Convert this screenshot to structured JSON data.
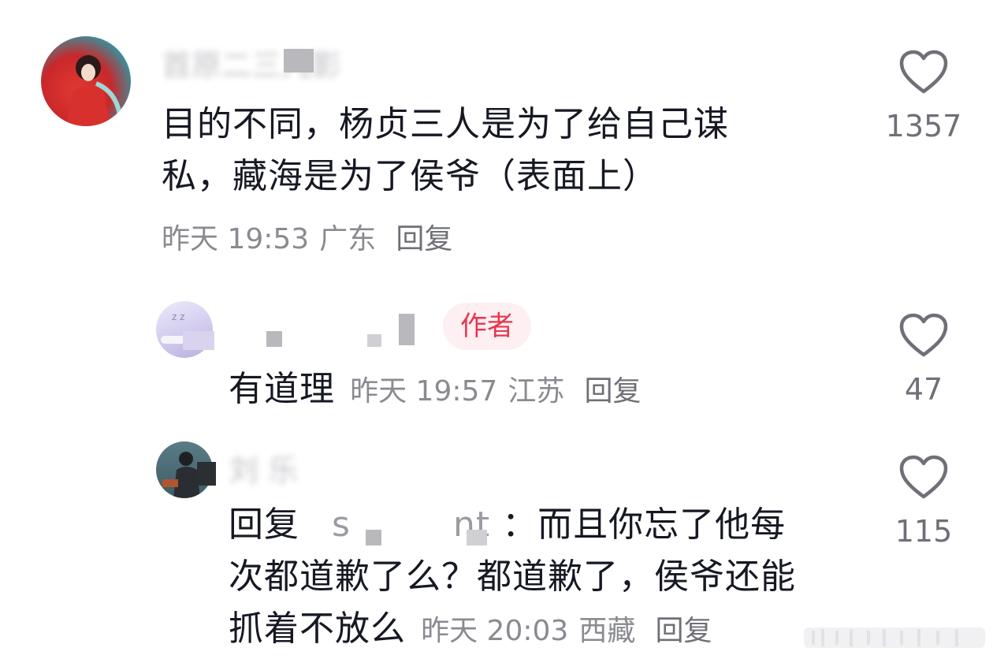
{
  "comments": [
    {
      "username": "首原二三几影",
      "text_line1": "目的不同，杨贞三人是为了给自己谋",
      "text_line2": "私，藏海是为了侯爷（表面上）",
      "time": "昨天 19:53",
      "location": "广东",
      "reply_label": "回复",
      "likes": "1357"
    },
    {
      "username": "",
      "author_tag": "作者",
      "text": "有道理",
      "time": "昨天 19:57",
      "location": "江苏",
      "reply_label": "回复",
      "likes": "47"
    },
    {
      "username": "刘 乐",
      "reply_prefix": "回复",
      "quoted_user_start": "s",
      "quoted_user_end": "nt",
      "text_line1": "：而且你忘了他每",
      "text_line2": "次都道歉了么？都道歉了，侯爷还能",
      "text_line3": "抓着不放么",
      "time": "昨天 20:03",
      "location": "西藏",
      "reply_label": "回复",
      "likes": "115"
    }
  ],
  "icons": {
    "like": "heart-outline-icon"
  },
  "colors": {
    "author_tag_bg": "#fdeff2",
    "author_tag_text": "#e8364e",
    "meta_text": "#8a8b91",
    "main_text": "#161823"
  }
}
